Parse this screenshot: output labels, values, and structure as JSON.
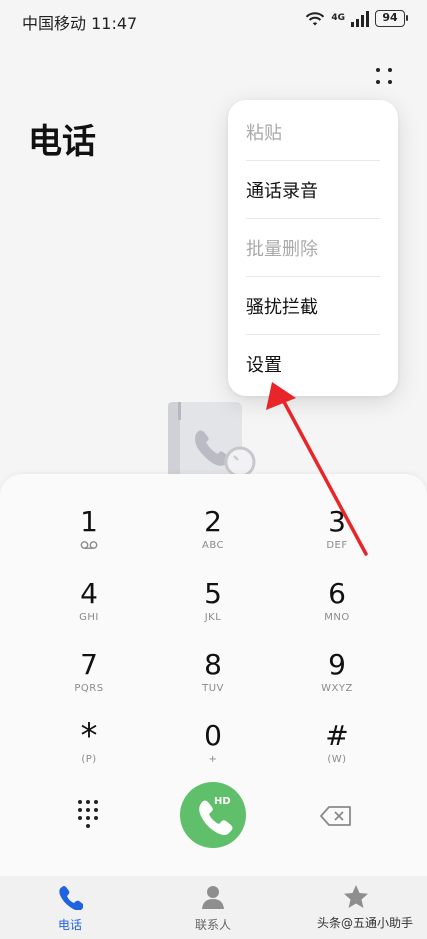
{
  "status_bar": {
    "carrier_time": "中国移动 11:47",
    "network": "4G",
    "battery": "94"
  },
  "header": {
    "title": "电话"
  },
  "menu": {
    "items": [
      {
        "label": "粘贴",
        "disabled": true
      },
      {
        "label": "通话录音",
        "disabled": false
      },
      {
        "label": "批量删除",
        "disabled": true
      },
      {
        "label": "骚扰拦截",
        "disabled": false
      },
      {
        "label": "设置",
        "disabled": false
      }
    ]
  },
  "dialpad": {
    "keys": [
      {
        "digit": "1",
        "letters": ""
      },
      {
        "digit": "2",
        "letters": "ABC"
      },
      {
        "digit": "3",
        "letters": "DEF"
      },
      {
        "digit": "4",
        "letters": "GHI"
      },
      {
        "digit": "5",
        "letters": "JKL"
      },
      {
        "digit": "6",
        "letters": "MNO"
      },
      {
        "digit": "7",
        "letters": "PQRS"
      },
      {
        "digit": "8",
        "letters": "TUV"
      },
      {
        "digit": "9",
        "letters": "WXYZ"
      },
      {
        "digit": "*",
        "letters": "(P)"
      },
      {
        "digit": "0",
        "letters": "+"
      },
      {
        "digit": "#",
        "letters": "(W)"
      }
    ],
    "call_badge": "HD"
  },
  "bottom_nav": {
    "tabs": [
      {
        "label": "电话",
        "icon": "phone-icon",
        "active": true
      },
      {
        "label": "联系人",
        "icon": "contact-icon",
        "active": false
      },
      {
        "label": "",
        "icon": "star-icon",
        "active": false
      }
    ]
  },
  "watermark": "头条@五通小助手",
  "colors": {
    "accent": "#1f63e0",
    "call_green": "#5fbf6a",
    "annotation_red": "#e8262a",
    "disabled_text": "#aaaaaa"
  }
}
